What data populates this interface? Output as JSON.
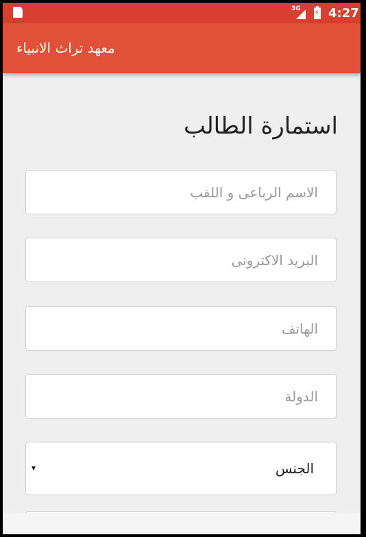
{
  "status_bar": {
    "network": "3G",
    "time": "4:27"
  },
  "app_bar": {
    "title": "معهد تراث الانبياء"
  },
  "form": {
    "title": "استمارة الطالب",
    "fields": [
      {
        "placeholder": "الاسم الرباعى و اللقب",
        "value": ""
      },
      {
        "placeholder": "البريد الاكترونى",
        "value": ""
      },
      {
        "placeholder": "الهاتف",
        "value": ""
      },
      {
        "placeholder": "الدولة",
        "value": ""
      }
    ],
    "gender_select": {
      "label": "الجنس",
      "arrow": "▾"
    }
  },
  "colors": {
    "status_bar": "#d83f2e",
    "app_bar": "#e15038",
    "background": "#efefef"
  },
  "icons": [
    "sd-card-icon",
    "signal-icon",
    "battery-charging-icon"
  ]
}
